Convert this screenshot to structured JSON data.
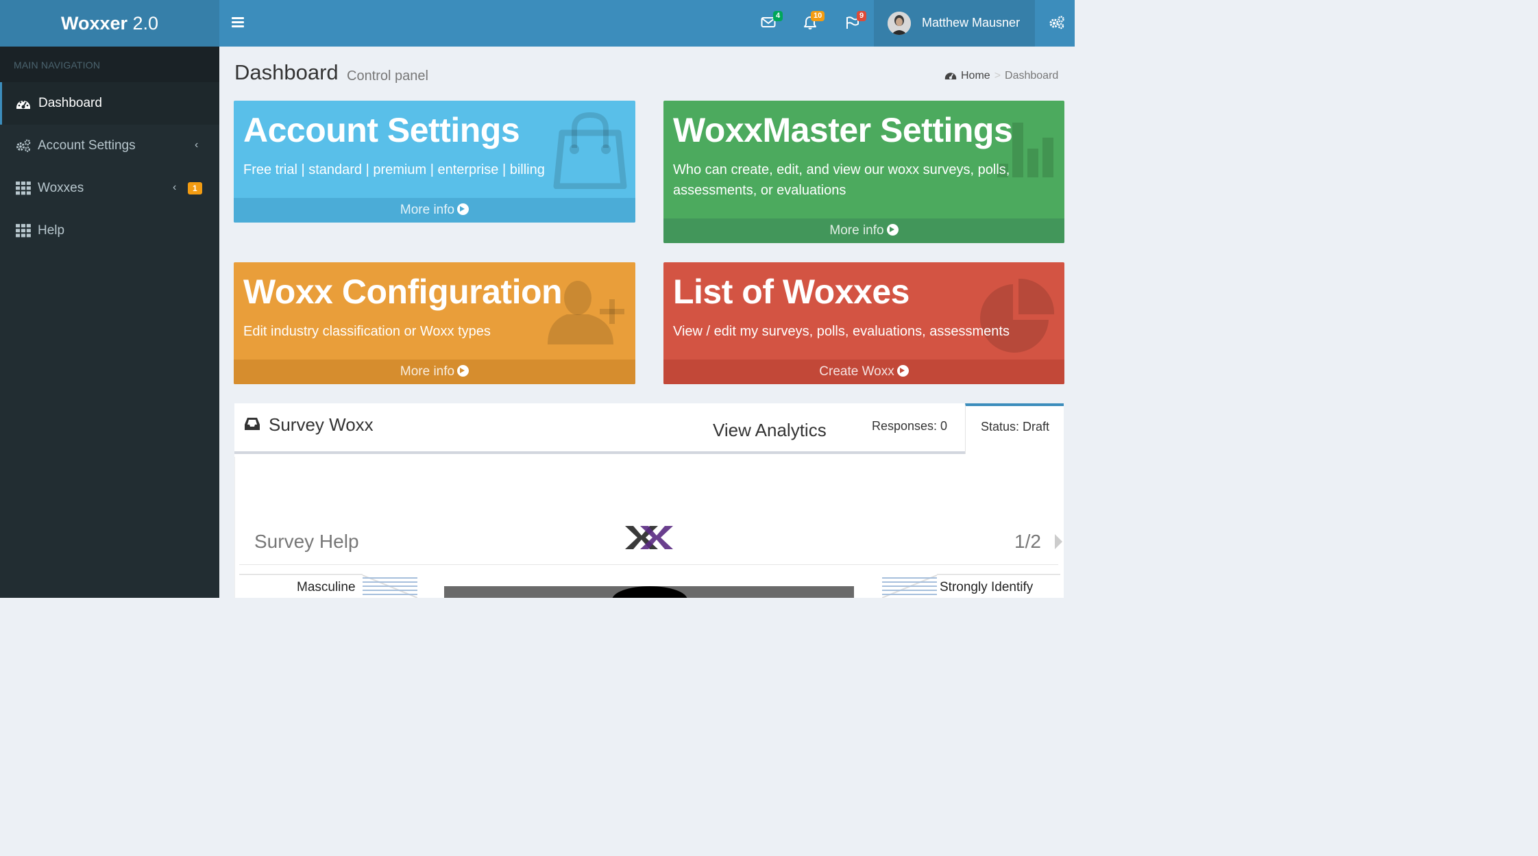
{
  "header": {
    "logo_bold": "Woxxer",
    "logo_version": " 2.0",
    "notifications": [
      {
        "icon": "envelope-icon",
        "count": "4",
        "color": "#00a65a"
      },
      {
        "icon": "bell-icon",
        "count": "10",
        "color": "#f39c12"
      },
      {
        "icon": "flag-icon",
        "count": "9",
        "color": "#dd4b39"
      }
    ],
    "user_name": "Matthew Mausner"
  },
  "sidebar": {
    "header": "MAIN NAVIGATION",
    "items": [
      {
        "label": "Dashboard",
        "icon": "dashboard-icon",
        "active": true
      },
      {
        "label": "Account Settings",
        "icon": "gears-icon"
      },
      {
        "label": "Woxxes",
        "icon": "grid-icon",
        "badge": "1"
      },
      {
        "label": "Help",
        "icon": "grid-icon"
      }
    ]
  },
  "content": {
    "title": "Dashboard",
    "subtitle": "Control panel",
    "breadcrumb": {
      "home": "Home",
      "current": "Dashboard"
    }
  },
  "boxes": [
    {
      "title": "Account Settings",
      "text": "Free trial | standard | premium | enterprise | billing",
      "footer": "More info",
      "color": "#59bfe9",
      "icon": "shopping-bag-icon"
    },
    {
      "title": "WoxxMaster Settings",
      "text": "Who can create, edit, and view our woxx surveys, polls, assessments, or evaluations",
      "footer": "More info",
      "color": "#4caa5e",
      "icon": "bar-chart-icon"
    },
    {
      "title": "Woxx Configuration",
      "text": "Edit industry classification or Woxx types",
      "footer": "More info",
      "color": "#e99e3a",
      "icon": "user-add-icon"
    },
    {
      "title": "List of Woxxes",
      "text": "View / edit my surveys, polls, evaluations, assessments",
      "footer": "Create Woxx",
      "color": "#d35443",
      "icon": "pie-chart-icon"
    }
  ],
  "survey": {
    "title": "Survey Woxx",
    "view_analytics": "View Analytics",
    "responses": "Responses: 0",
    "status": "Status: Draft",
    "help_label": "Survey Help",
    "page": "1/2",
    "scale_left": "Masculine",
    "scale_right": "Strongly Identify"
  }
}
